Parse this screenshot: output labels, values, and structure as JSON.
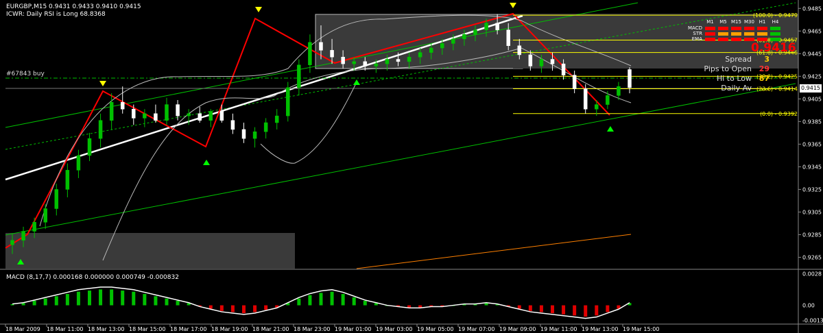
{
  "chart": {
    "symbol_line": "EURGBP,M15  0.9431 0.9433 0.9410 0.9415",
    "indicator_line": "ICWR: Daily RSI is Long 68.8368",
    "order_label": "#67843 buy",
    "current_price": "0.9415",
    "big_price": "0.9416",
    "colors": {
      "background": "#000000",
      "bull": "#00c000",
      "bear": "#ffffff",
      "trend_green": "#00c000",
      "red_line": "#ff0000",
      "fib": "#ffff00",
      "band": "#c0c0c0"
    }
  },
  "chart_data": [
    {
      "type": "line",
      "title": "EURGBP,M15",
      "ylabel": "",
      "y_ticks": [
        "0.9485",
        "0.9465",
        "0.9445",
        "0.9425",
        "0.9405",
        "0.9385",
        "0.9365",
        "0.9345",
        "0.9325",
        "0.9305",
        "0.9285",
        "0.9265"
      ],
      "ylim": [
        0.9255,
        0.949
      ],
      "x_ticks": [
        "18 Mar 2009",
        "18 Mar 11:00",
        "18 Mar 13:00",
        "18 Mar 15:00",
        "18 Mar 17:00",
        "18 Mar 19:00",
        "18 Mar 21:00",
        "18 Mar 23:00",
        "19 Mar 01:00",
        "19 Mar 03:00",
        "19 Mar 05:00",
        "19 Mar 07:00",
        "19 Mar 09:00",
        "19 Mar 11:00",
        "19 Mar 13:00",
        "19 Mar 15:00"
      ],
      "grid": false,
      "candles": [
        [
          0.9276,
          0.9286,
          0.9268,
          0.928
        ],
        [
          0.928,
          0.9292,
          0.9274,
          0.9288
        ],
        [
          0.9288,
          0.93,
          0.9282,
          0.9296
        ],
        [
          0.9296,
          0.9312,
          0.929,
          0.9308
        ],
        [
          0.9308,
          0.933,
          0.9302,
          0.9325
        ],
        [
          0.9325,
          0.9348,
          0.9318,
          0.9342
        ],
        [
          0.9342,
          0.936,
          0.9335,
          0.9355
        ],
        [
          0.9355,
          0.9375,
          0.935,
          0.937
        ],
        [
          0.937,
          0.9392,
          0.9362,
          0.9386
        ],
        [
          0.9386,
          0.941,
          0.9378,
          0.9402
        ],
        [
          0.9402,
          0.9416,
          0.9392,
          0.9396
        ],
        [
          0.9396,
          0.94,
          0.9382,
          0.9388
        ],
        [
          0.9388,
          0.9396,
          0.938,
          0.9392
        ],
        [
          0.9392,
          0.94,
          0.9384,
          0.9386
        ],
        [
          0.9386,
          0.9406,
          0.9382,
          0.94
        ],
        [
          0.94,
          0.9404,
          0.9386,
          0.939
        ],
        [
          0.939,
          0.9396,
          0.9382,
          0.9392
        ],
        [
          0.9392,
          0.9398,
          0.9384,
          0.9386
        ],
        [
          0.9386,
          0.9396,
          0.938,
          0.9394
        ],
        [
          0.9394,
          0.94,
          0.9384,
          0.9386
        ],
        [
          0.9386,
          0.9392,
          0.9374,
          0.9378
        ],
        [
          0.9378,
          0.9384,
          0.9366,
          0.937
        ],
        [
          0.937,
          0.938,
          0.9362,
          0.9376
        ],
        [
          0.9376,
          0.9388,
          0.937,
          0.9384
        ],
        [
          0.9384,
          0.9396,
          0.9378,
          0.939
        ],
        [
          0.939,
          0.942,
          0.9385,
          0.9415
        ],
        [
          0.9415,
          0.944,
          0.9408,
          0.9435
        ],
        [
          0.9435,
          0.9462,
          0.9428,
          0.9455
        ],
        [
          0.9455,
          0.947,
          0.944,
          0.9448
        ],
        [
          0.9448,
          0.9458,
          0.9436,
          0.9442
        ],
        [
          0.9442,
          0.9448,
          0.9432,
          0.9436
        ],
        [
          0.9436,
          0.9442,
          0.943,
          0.9438
        ],
        [
          0.9438,
          0.9442,
          0.943,
          0.9434
        ],
        [
          0.9434,
          0.944,
          0.9428,
          0.9436
        ],
        [
          0.9436,
          0.9444,
          0.943,
          0.944
        ],
        [
          0.944,
          0.9446,
          0.9434,
          0.9438
        ],
        [
          0.9438,
          0.9446,
          0.9432,
          0.9442
        ],
        [
          0.9442,
          0.945,
          0.9436,
          0.9446
        ],
        [
          0.9446,
          0.9454,
          0.944,
          0.945
        ],
        [
          0.945,
          0.9458,
          0.9444,
          0.9454
        ],
        [
          0.9454,
          0.9462,
          0.9448,
          0.9458
        ],
        [
          0.9458,
          0.9466,
          0.9452,
          0.9462
        ],
        [
          0.9462,
          0.947,
          0.9456,
          0.9466
        ],
        [
          0.9466,
          0.9476,
          0.946,
          0.9472
        ],
        [
          0.9472,
          0.948,
          0.9462,
          0.9466
        ],
        [
          0.9466,
          0.9472,
          0.9448,
          0.9452
        ],
        [
          0.9452,
          0.9458,
          0.944,
          0.9444
        ],
        [
          0.9444,
          0.9448,
          0.943,
          0.9434
        ],
        [
          0.9434,
          0.9444,
          0.9428,
          0.944
        ],
        [
          0.944,
          0.9446,
          0.943,
          0.9436
        ],
        [
          0.9436,
          0.944,
          0.9422,
          0.9426
        ],
        [
          0.9426,
          0.943,
          0.941,
          0.9414
        ],
        [
          0.9414,
          0.9418,
          0.9392,
          0.9396
        ],
        [
          0.9396,
          0.9404,
          0.939,
          0.94
        ],
        [
          0.94,
          0.9412,
          0.9396,
          0.9408
        ],
        [
          0.9408,
          0.942,
          0.9404,
          0.9416
        ],
        [
          0.9431,
          0.9433,
          0.941,
          0.9415
        ]
      ],
      "fib_levels": [
        {
          "label": "(100.0) - 0.9479",
          "value": 0.9479
        },
        {
          "label": "(61.8) - 0.9457",
          "value": 0.9457
        },
        {
          "label": "(61.8) - 0.9446",
          "value": 0.9446
        },
        {
          "label": "(38.2) - 0.9425",
          "value": 0.9425
        },
        {
          "label": "(23.6) - 0.9414",
          "value": 0.9414
        },
        {
          "label": "(0.0) - 0.9392",
          "value": 0.9392
        }
      ]
    },
    {
      "type": "bar",
      "title": "MACD (8,17,7) 0.000168 0.000000 0.000749 -0.000832",
      "y_ticks": [
        "0.0028",
        "0.00",
        "-0.00132"
      ],
      "ylim": [
        -0.0016,
        0.003
      ],
      "series": [
        {
          "values": [
            0.0001,
            0.0002,
            0.0004,
            0.0006,
            0.0008,
            0.001,
            0.0012,
            0.0013,
            0.0014,
            0.0014,
            0.0013,
            0.0012,
            0.001,
            0.0008,
            0.0006,
            0.0004,
            0.0002,
            -0.0001,
            -0.0003,
            -0.0005,
            -0.0006,
            -0.0007,
            -0.0006,
            -0.0004,
            -0.0002,
            0.0002,
            0.0006,
            0.0009,
            0.0011,
            0.0012,
            0.001,
            0.0007,
            0.0004,
            0.0002,
            0.0,
            -0.0001,
            -0.0002,
            -0.0002,
            -0.0001,
            -0.0001,
            0.0,
            0.0001,
            0.0001,
            0.0002,
            0.0001,
            -0.0001,
            -0.0003,
            -0.0005,
            -0.0006,
            -0.0007,
            -0.0008,
            -0.0009,
            -0.001,
            -0.0009,
            -0.0006,
            -0.0003,
            0.0002
          ]
        }
      ]
    }
  ],
  "stats": {
    "spread_label": "Spread",
    "spread_value": "3",
    "pips_label": "Pips to Open",
    "pips_value": "29",
    "hilo_label": "Hi to Low",
    "hilo_value": "87",
    "daily_label": "Daily Av",
    "daily_value": "..."
  },
  "signal_panel": {
    "timeframes": [
      "M1",
      "M5",
      "M15",
      "M30",
      "H1",
      "H4"
    ],
    "rows": [
      {
        "label": "MACD",
        "colors": [
          "#ff0000",
          "#ff0000",
          "#ff0000",
          "#ff0000",
          "#ff0000",
          "#00c000"
        ]
      },
      {
        "label": "STR",
        "colors": [
          "#ff0000",
          "#ffa000",
          "#ffa000",
          "#ffa000",
          "#ffa000",
          "#00c000"
        ]
      },
      {
        "label": "EMA",
        "colors": [
          "#ff0000",
          "#ff0000",
          "#ff0000",
          "#ff0000",
          "#ff0000",
          "#00c000"
        ]
      }
    ]
  }
}
